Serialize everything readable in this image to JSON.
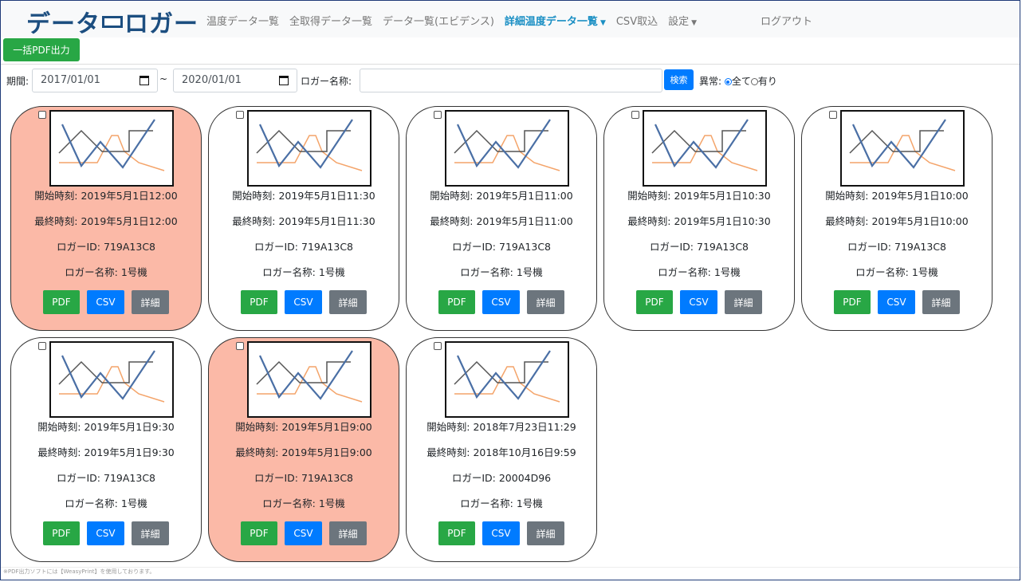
{
  "brand": {
    "part1": "データ",
    "part2": "ロガー"
  },
  "nav": {
    "items": [
      "温度データ一覧",
      "全取得データ一覧",
      "データ一覧(エビデンス)",
      "詳細温度データ一覧",
      "CSV取込",
      "設定"
    ],
    "logout": "ログアウト"
  },
  "toolbar": {
    "pdf_all": "一括PDF出力"
  },
  "filter": {
    "period_label": "期間:",
    "date_from": "2017/01/01",
    "tilde": "~",
    "date_to": "2020/01/01",
    "logger_name_label": "ロガー名称:",
    "logger_name_value": "",
    "search_label": "検索",
    "abnormal_label": "異常:",
    "opt_all": "全て",
    "opt_yes": "有り",
    "selected": "全て"
  },
  "card_labels": {
    "start": "開始時刻: ",
    "end": "最終時刻: ",
    "id": "ロガーID: ",
    "name": "ロガー名称: "
  },
  "buttons": {
    "pdf": "PDF",
    "csv": "CSV",
    "detail": "詳細"
  },
  "cards": [
    {
      "start": "2019年5月1日12:00",
      "end": "2019年5月1日12:00",
      "id": "719A13C8",
      "name": "1号機",
      "abnormal": true
    },
    {
      "start": "2019年5月1日11:30",
      "end": "2019年5月1日11:30",
      "id": "719A13C8",
      "name": "1号機",
      "abnormal": false
    },
    {
      "start": "2019年5月1日11:00",
      "end": "2019年5月1日11:00",
      "id": "719A13C8",
      "name": "1号機",
      "abnormal": false
    },
    {
      "start": "2019年5月1日10:30",
      "end": "2019年5月1日10:30",
      "id": "719A13C8",
      "name": "1号機",
      "abnormal": false
    },
    {
      "start": "2019年5月1日10:00",
      "end": "2019年5月1日10:00",
      "id": "719A13C8",
      "name": "1号機",
      "abnormal": false
    },
    {
      "start": "2019年5月1日9:30",
      "end": "2019年5月1日9:30",
      "id": "719A13C8",
      "name": "1号機",
      "abnormal": false
    },
    {
      "start": "2019年5月1日9:00",
      "end": "2019年5月1日9:00",
      "id": "719A13C8",
      "name": "1号機",
      "abnormal": true
    },
    {
      "start": "2018年7月23日11:29",
      "end": "2018年10月16日9:59",
      "id": "20004D96",
      "name": "1号機",
      "abnormal": false
    }
  ],
  "colors": {
    "abnormal_bg": "#fbb9a7",
    "pdf": "#28a745",
    "csv": "#007bff",
    "detail": "#6c757d",
    "brand": "#1c4e80"
  },
  "footer": "※PDF出力ソフトには【WeasyPrint】を使用しております。"
}
